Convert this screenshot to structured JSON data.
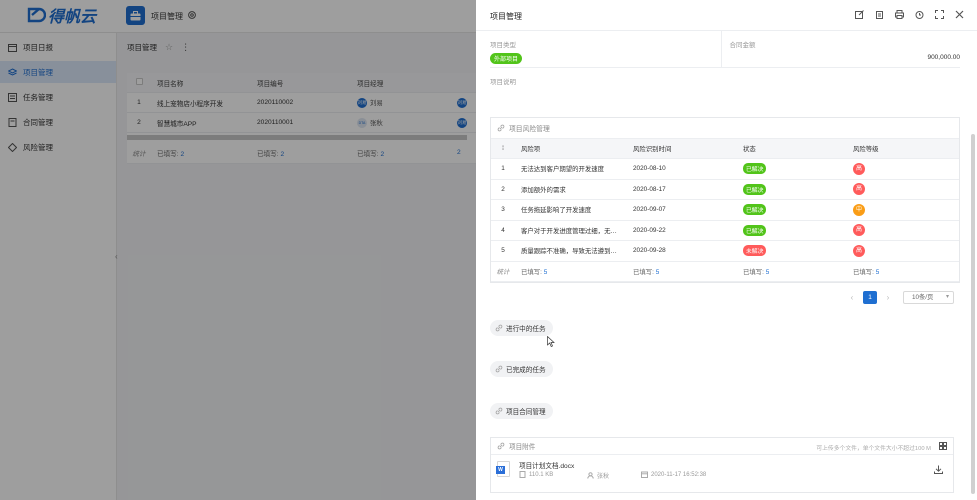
{
  "app": {
    "brand": "得帆云",
    "module_title": "项目管理"
  },
  "sidebar": {
    "items": [
      {
        "label": "项目日报",
        "icon": "calendar-icon",
        "active": false
      },
      {
        "label": "项目管理",
        "icon": "layers-icon",
        "active": true
      },
      {
        "label": "任务管理",
        "icon": "list-icon",
        "active": false
      },
      {
        "label": "合同管理",
        "icon": "contract-icon",
        "active": false
      },
      {
        "label": "风险管理",
        "icon": "risk-icon",
        "active": false
      }
    ]
  },
  "list_page": {
    "title": "项目管理",
    "columns": [
      "",
      "项目名称",
      "项目编号",
      "项目经理",
      ""
    ],
    "rows": [
      {
        "index": "1",
        "name": "线上宠物店小程序开发",
        "code": "2020110002",
        "manager_avatar": "刘易",
        "manager": "刘易",
        "extra_avatar": "刘易"
      },
      {
        "index": "2",
        "name": "智慧城市APP",
        "code": "2020110001",
        "manager_avatar": "DTA",
        "manager": "张秋",
        "extra_avatar": "刘易"
      }
    ],
    "footer": {
      "label": "统计",
      "filled": "已填写:",
      "count1": "2",
      "count2": "2",
      "count3": "2",
      "count4": "2"
    }
  },
  "drawer": {
    "title": "项目管理",
    "tools": [
      "edit-icon",
      "copy-icon",
      "print-icon",
      "clock-icon",
      "fullscreen-icon",
      "close-icon"
    ],
    "fields": {
      "type_label": "项目类型",
      "type_value": "外部项目",
      "amount_label": "合同金额",
      "amount_value": "900,000.00",
      "desc_label": "项目说明"
    },
    "risk": {
      "title": "项目风险管理",
      "columns": [
        "",
        "风险项",
        "风险识别时间",
        "状态",
        "风险等级"
      ],
      "rows": [
        {
          "index": "1",
          "item": "无法达到客户期望的开发速度",
          "date": "2020-08-10",
          "status": "已解决",
          "status_kind": "ok",
          "level": "高",
          "level_kind": "high"
        },
        {
          "index": "2",
          "item": "添加额外的需求",
          "date": "2020-08-17",
          "status": "已解决",
          "status_kind": "ok",
          "level": "高",
          "level_kind": "high"
        },
        {
          "index": "3",
          "item": "任务拖延影响了开发速度",
          "date": "2020-09-07",
          "status": "已解决",
          "status_kind": "ok",
          "level": "中",
          "level_kind": "mid"
        },
        {
          "index": "4",
          "item": "客户对于开发进度管理过细，无…",
          "date": "2020-09-22",
          "status": "已解决",
          "status_kind": "ok",
          "level": "高",
          "level_kind": "high"
        },
        {
          "index": "5",
          "item": "质量跟踪不准确，导致无法遵到…",
          "date": "2020-09-28",
          "status": "未解决",
          "status_kind": "no",
          "level": "高",
          "level_kind": "high"
        }
      ],
      "footer": {
        "label": "统计",
        "filled": "已填写:",
        "count": "5"
      }
    },
    "pager": {
      "prev": "‹",
      "current": "1",
      "next": "›",
      "page_size": "10条/页"
    },
    "sections": [
      "进行中的任务",
      "已完成的任务",
      "项目合同管理"
    ],
    "attachments": {
      "title": "项目附件",
      "hint": "可上传多个文件，单个文件大小不超过100 M",
      "file": {
        "name": "项目计划文档.docx",
        "size": "110.1 KB",
        "uploader": "张秋",
        "time": "2020-11-17 16:52:38"
      }
    }
  },
  "colors": {
    "brand": "#1f6fd1",
    "success": "#52c41a",
    "danger": "#ff5b5b",
    "warning": "#fa9d16"
  }
}
